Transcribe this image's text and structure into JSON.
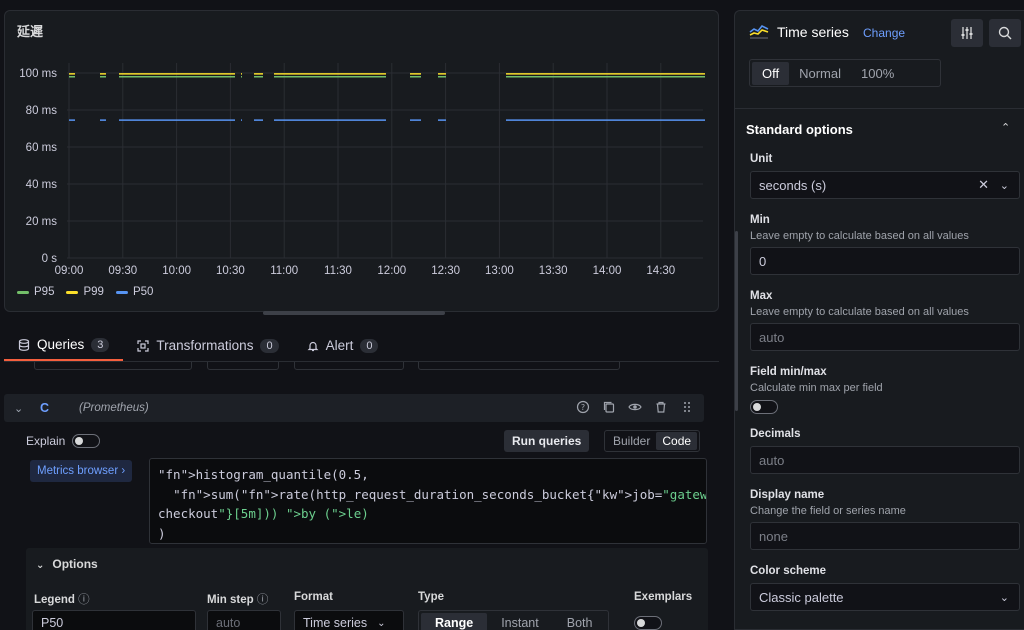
{
  "panel": {
    "title": "延遲"
  },
  "chart_data": {
    "type": "line",
    "yticks": [
      "0 s",
      "20 ms",
      "40 ms",
      "60 ms",
      "80 ms",
      "100 ms"
    ],
    "xticks": [
      "09:00",
      "09:30",
      "10:00",
      "10:30",
      "11:00",
      "11:30",
      "12:00",
      "12:30",
      "13:00",
      "13:30",
      "14:00",
      "14:30"
    ],
    "ylim": [
      0,
      100
    ],
    "yunit": "ms",
    "series": [
      {
        "name": "P95",
        "color": "#73bf69",
        "value": 98
      },
      {
        "name": "P99",
        "color": "#fade2a",
        "value": 99.5
      },
      {
        "name": "P50",
        "color": "#5794f2",
        "value": 74.5
      }
    ]
  },
  "tabs": [
    {
      "label": "Queries",
      "count": "3",
      "icon": "database-icon"
    },
    {
      "label": "Transformations",
      "count": "0",
      "icon": "transform-icon"
    },
    {
      "label": "Alert",
      "count": "0",
      "icon": "bell-icon"
    }
  ],
  "query": {
    "letter": "C",
    "datasource": "(Prometheus)",
    "explain_label": "Explain",
    "run_label": "Run queries",
    "mode_builder": "Builder",
    "mode_code": "Code",
    "metrics_browser": "Metrics browser ›",
    "code_lines": [
      "histogram_quantile(0.5,",
      "  sum(rate(http_request_duration_seconds_bucket{job=\"gateway\", path=\"/",
      "checkout\"}[5m])) by (le)",
      ")"
    ]
  },
  "options": {
    "title": "Options",
    "legend_label": "Legend",
    "legend_value": "P50",
    "minstep_label": "Min step",
    "minstep_placeholder": "auto",
    "format_label": "Format",
    "format_value": "Time series",
    "type_label": "Type",
    "type_options": [
      "Range",
      "Instant",
      "Both"
    ],
    "exemplars_label": "Exemplars"
  },
  "side": {
    "viz_title": "Time series",
    "change_label": "Change",
    "stack_options": [
      "Off",
      "Normal",
      "100%"
    ],
    "section_title": "Standard options",
    "unit_label": "Unit",
    "unit_value": "seconds (s)",
    "min_label": "Min",
    "min_desc": "Leave empty to calculate based on all values",
    "min_value": "0",
    "max_label": "Max",
    "max_desc": "Leave empty to calculate based on all values",
    "max_placeholder": "auto",
    "fieldminmax_label": "Field min/max",
    "fieldminmax_desc": "Calculate min max per field",
    "decimals_label": "Decimals",
    "decimals_placeholder": "auto",
    "displayname_label": "Display name",
    "displayname_desc": "Change the field or series name",
    "displayname_placeholder": "none",
    "colorscheme_label": "Color scheme",
    "colorscheme_value": "Classic palette"
  }
}
